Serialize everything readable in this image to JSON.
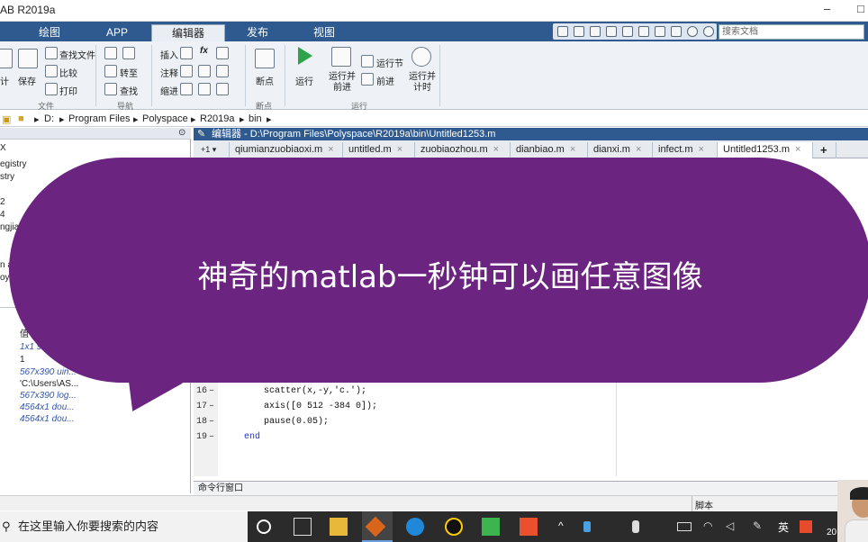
{
  "window": {
    "title": "AB R2019a",
    "minimize": "–",
    "maximize": "□"
  },
  "ribbon_tabs": [
    "绘图",
    "APP",
    "编辑器",
    "发布",
    "视图"
  ],
  "search_docs_placeholder": "搜索文档",
  "toolstrip": {
    "file": {
      "label": "文件",
      "save": "保存",
      "find_files": "查找文件",
      "compare": "比较",
      "print": "打印",
      "new_partial": "计"
    },
    "nav": {
      "label": "导航",
      "goto": "转至",
      "find": "查找"
    },
    "edit": {
      "insert": "插入",
      "comment": "注释",
      "indent": "缩进",
      "fx": "fx"
    },
    "breakpoints": {
      "label": "断点",
      "btn": "断点"
    },
    "run": {
      "label": "运行",
      "run": "运行",
      "run_advance": "运行并\n前进",
      "run_section": "运行节",
      "advance": "前进",
      "run_time": "运行并\n计时"
    }
  },
  "address_path": [
    "D:",
    "Program Files",
    "Polyspace",
    "R2019a",
    "bin"
  ],
  "left_panel": {
    "items_top": [
      "X",
      "egistry",
      "stry",
      "2",
      "4",
      "ngjia",
      "n a",
      "oy"
    ],
    "value_header": "值",
    "values": [
      {
        "text": "1x1 s",
        "italic": true
      },
      {
        "text": "1",
        "italic": false
      },
      {
        "text": "567x390 uin...",
        "italic": true
      },
      {
        "text": "'C:\\Users\\AS...",
        "italic": false
      },
      {
        "text": "567x390 log...",
        "italic": true
      },
      {
        "text": "4564x1 dou...",
        "italic": true
      },
      {
        "text": "4564x1 dou...",
        "italic": true
      }
    ]
  },
  "editor": {
    "header": "编辑器 - D:\\Program Files\\Polyspace\\R2019a\\bin\\Untitled1253.m",
    "tabs": [
      "qiumianzuobiaoxi.m",
      "untitled.m",
      "zuobiaozhou.m",
      "dianbiao.m",
      "dianxi.m",
      "infect.m",
      "Untitled1253.m"
    ],
    "active_tab": "Untitled1253.m",
    "lines": [
      {
        "num": "16",
        "code": "scatter(x,-y,'c.');"
      },
      {
        "num": "17",
        "code": "axis([0 512 -384 0]);"
      },
      {
        "num": "18",
        "code": "pause(0.05);"
      },
      {
        "num": "19",
        "code": "end"
      }
    ]
  },
  "command_window": "命令行窗口",
  "status": {
    "type": "脚本"
  },
  "taskbar": {
    "search": "在这里输入你要搜索的内容",
    "ime": "英",
    "clock": "20"
  },
  "overlay": {
    "caption": "神奇的matlab一秒钟可以画任意图像"
  },
  "colors": {
    "ribbon": "#2e5a90",
    "bubble": "#6b2480",
    "run_green": "#2ea44a"
  }
}
